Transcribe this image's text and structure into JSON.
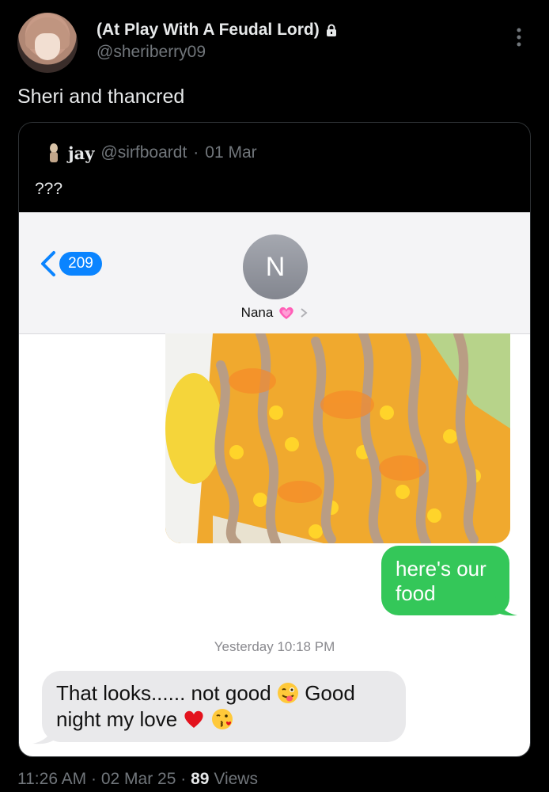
{
  "post": {
    "display_name": "(At Play With A Feudal Lord)",
    "handle": "@sheriberry09",
    "text": "Sheri and thancred",
    "time": "11:26 AM",
    "date": "02 Mar 25",
    "separator": "·",
    "views_count": "89",
    "views_label": "Views"
  },
  "quoted": {
    "name": "jay",
    "handle": "@sirfboardt",
    "separator": "·",
    "date": "01 Mar",
    "text": "???"
  },
  "imessage": {
    "unread_count": "209",
    "contact_initial": "N",
    "contact_name": "Nana",
    "outgoing_message": "here's our food",
    "timestamp": "Yesterday 10:18 PM",
    "incoming_message_part1": "That looks...... not good",
    "incoming_message_part2": "Good night my love"
  },
  "colors": {
    "imessage_blue": "#0a84ff",
    "sms_green": "#34c759",
    "incoming_bubble": "#e9e9eb",
    "muted_text": "#71767b"
  },
  "icons": [
    "lock-icon",
    "more-icon",
    "back-chevron-icon",
    "pink-heart-icon",
    "chevron-right-icon",
    "winking-tongue-emoji-icon",
    "red-heart-emoji-icon",
    "kiss-emoji-icon"
  ]
}
